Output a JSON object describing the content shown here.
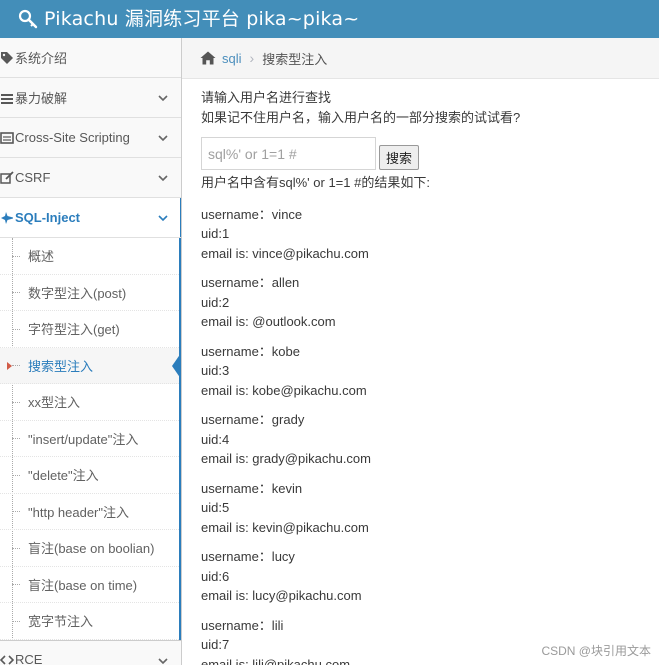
{
  "app": {
    "title": "Pikachu 漏洞练习平台 pika~pika~",
    "brand_color": "#438eb9",
    "logo_icon": "wrench-key-icon"
  },
  "sidebar": {
    "items": [
      {
        "label": "系统介绍",
        "icon": "tag-icon",
        "has_chevron": false
      },
      {
        "label": "暴力破解",
        "icon": "bars-icon",
        "has_chevron": true
      },
      {
        "label": "Cross-Site Scripting",
        "icon": "list-icon",
        "has_chevron": true
      },
      {
        "label": "CSRF",
        "icon": "edit-icon",
        "has_chevron": true
      },
      {
        "label": "SQL-Inject",
        "icon": "fighter-jet-icon",
        "has_chevron": true,
        "active": true
      }
    ],
    "submenu": [
      {
        "label": "概述"
      },
      {
        "label": "数字型注入(post)"
      },
      {
        "label": "字符型注入(get)"
      },
      {
        "label": "搜索型注入",
        "active": true
      },
      {
        "label": "xx型注入"
      },
      {
        "label": "\"insert/update\"注入"
      },
      {
        "label": "\"delete\"注入"
      },
      {
        "label": "\"http header\"注入"
      },
      {
        "label": "盲注(base on boolian)"
      },
      {
        "label": "盲注(base on time)"
      },
      {
        "label": "宽字节注入"
      }
    ],
    "bottom_item": {
      "label": "RCE",
      "icon": "code-icon"
    }
  },
  "breadcrumb": {
    "home_icon": "home-icon",
    "link": "sqli",
    "separator": "›",
    "current": "搜索型注入"
  },
  "main": {
    "intro_line1": "请输入用户名进行查找",
    "intro_line2": "如果记不住用户名，输入用户名的一部分搜索的试试看?",
    "search_placeholder": "sql%' or 1=1 #",
    "search_button": "搜索",
    "result_heading": "用户名中含有sql%' or 1=1 #的结果如下:",
    "records": [
      {
        "username": "username：vince",
        "uid": "uid:1",
        "email": "email is: vince@pikachu.com"
      },
      {
        "username": "username：allen",
        "uid": "uid:2",
        "email": "email is: @outlook.com"
      },
      {
        "username": "username：kobe",
        "uid": "uid:3",
        "email": "email is: kobe@pikachu.com"
      },
      {
        "username": "username：grady",
        "uid": "uid:4",
        "email": "email is: grady@pikachu.com"
      },
      {
        "username": "username：kevin",
        "uid": "uid:5",
        "email": "email is: kevin@pikachu.com"
      },
      {
        "username": "username：lucy",
        "uid": "uid:6",
        "email": "email is: lucy@pikachu.com"
      },
      {
        "username": "username：lili",
        "uid": "uid:7",
        "email": "email is: lili@pikachu.com"
      }
    ]
  },
  "watermark": "CSDN @块引用文本",
  "colors": {
    "accent": "#2b7dbc",
    "active_caret": "#d15b47"
  }
}
